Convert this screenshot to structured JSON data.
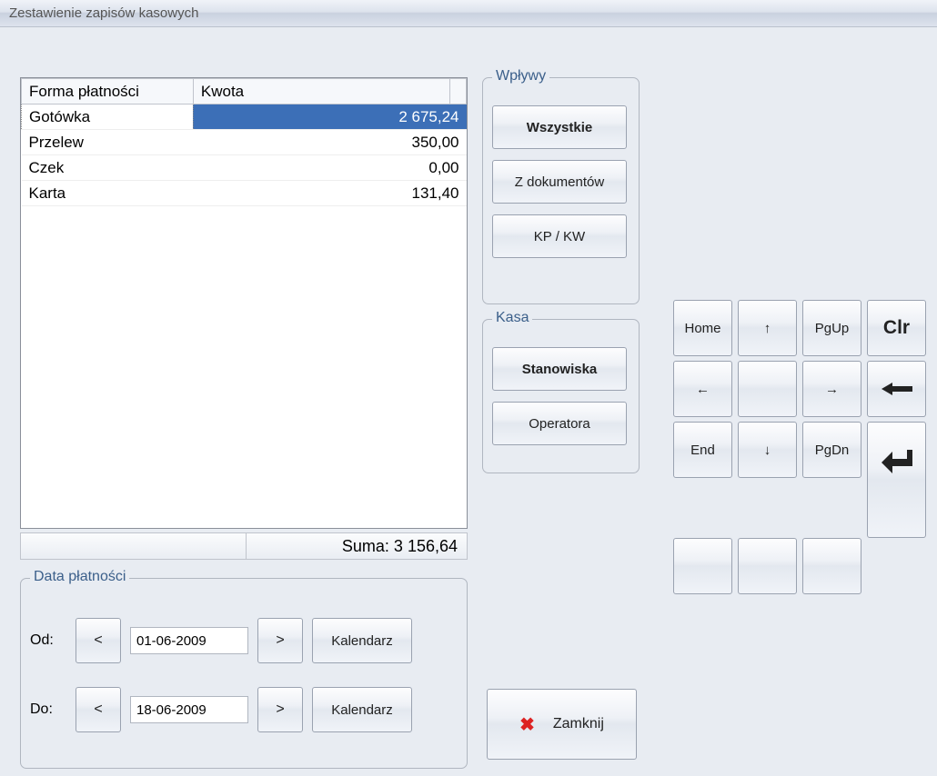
{
  "window": {
    "title": "Zestawienie zapisów kasowych"
  },
  "table": {
    "headers": {
      "forma": "Forma płatności",
      "kwota": "Kwota"
    },
    "rows": [
      {
        "forma": "Gotówka",
        "kwota": "2 675,24"
      },
      {
        "forma": "Przelew",
        "kwota": "350,00"
      },
      {
        "forma": "Czek",
        "kwota": "0,00"
      },
      {
        "forma": "Karta",
        "kwota": "131,40"
      }
    ],
    "sum_label": "Suma: 3 156,64"
  },
  "wplywy": {
    "title": "Wpływy",
    "btn_wszystkie": "Wszystkie",
    "btn_zdokumentow": "Z dokumentów",
    "btn_kpkw": "KP / KW"
  },
  "kasa": {
    "title": "Kasa",
    "btn_stanowiska": "Stanowiska",
    "btn_operatora": "Operatora"
  },
  "keypad": {
    "home": "Home",
    "pgup": "PgUp",
    "clr": "Clr",
    "end": "End",
    "pgdn": "PgDn"
  },
  "date_panel": {
    "title": "Data płatności",
    "od_label": "Od:",
    "do_label": "Do:",
    "od_value": "01-06-2009",
    "do_value": "18-06-2009",
    "prev": "<",
    "next": ">",
    "kalendarz": "Kalendarz"
  },
  "close": {
    "label": "Zamknij"
  }
}
